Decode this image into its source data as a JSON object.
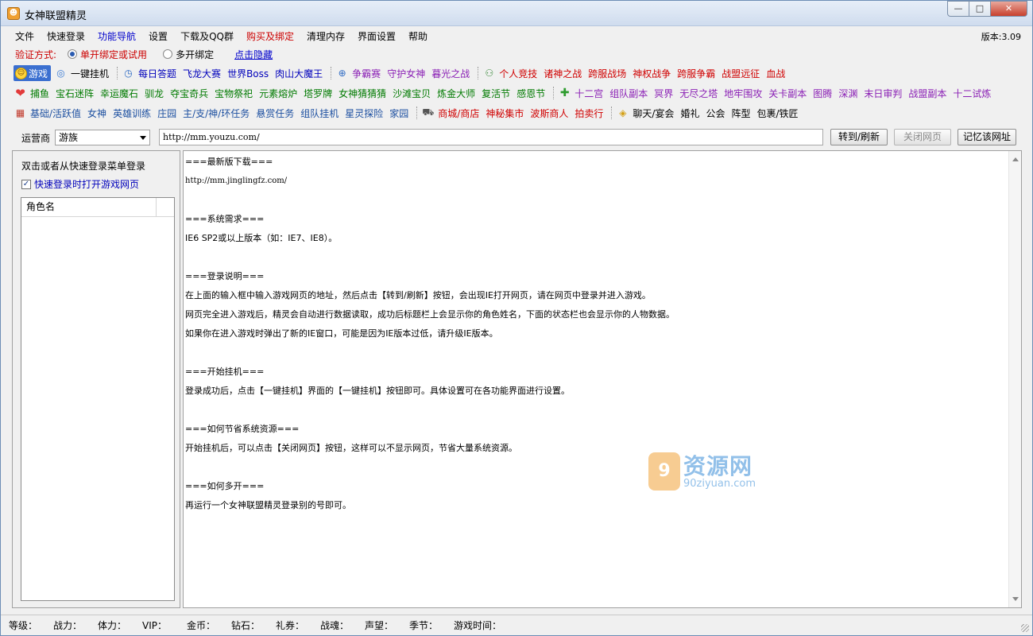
{
  "window": {
    "title": "女神联盟精灵",
    "controls": {
      "minimize": "—",
      "maximize": "□",
      "close": "✕"
    }
  },
  "menu": {
    "items": [
      {
        "label": "文件",
        "color": "black"
      },
      {
        "label": "快速登录",
        "color": "black"
      },
      {
        "label": "功能导航",
        "color": "blue"
      },
      {
        "label": "设置",
        "color": "black"
      },
      {
        "label": "下载及QQ群",
        "color": "black"
      },
      {
        "label": "购买及绑定",
        "color": "red"
      },
      {
        "label": "清理内存",
        "color": "black"
      },
      {
        "label": "界面设置",
        "color": "black"
      },
      {
        "label": "帮助",
        "color": "black"
      }
    ],
    "version": "版本:3.09"
  },
  "verify": {
    "label": "验证方式:",
    "option_single": "单开绑定或试用",
    "option_multi": "多开绑定",
    "hide_link": "点击隐藏"
  },
  "toolbar1": {
    "game": "游戏",
    "auto": "一键挂机",
    "group_a": [
      "每日答题",
      "飞龙大赛",
      "世界Boss",
      "肉山大魔王"
    ],
    "group_b": [
      "争霸赛",
      "守护女神",
      "暮光之战"
    ],
    "group_c": [
      "个人竞技",
      "诸神之战",
      "跨服战场",
      "神权战争",
      "跨服争霸",
      "战盟远征",
      "血战"
    ]
  },
  "toolbar2": {
    "group_a": [
      "捕鱼",
      "宝石迷阵",
      "幸运魔石",
      "驯龙",
      "夺宝奇兵",
      "宝物祭祀",
      "元素熔炉",
      "塔罗牌",
      "女神猜猜猜",
      "沙滩宝贝",
      "炼金大师",
      "复活节",
      "感恩节"
    ],
    "group_b": [
      "十二宫",
      "组队副本",
      "冥界",
      "无尽之塔",
      "地牢围攻",
      "关卡副本",
      "图腾",
      "深渊",
      "末日审判",
      "战盟副本",
      "十二试炼"
    ]
  },
  "toolbar3": {
    "group_a": [
      "基础/活跃值",
      "女神",
      "英雄训练",
      "庄园",
      "主/支/神/环任务",
      "悬赏任务",
      "组队挂机",
      "星灵探险",
      "家园"
    ],
    "group_b": [
      "商城/商店",
      "神秘集市",
      "波斯商人",
      "拍卖行"
    ],
    "group_c": [
      "聊天/宴会",
      "婚礼",
      "公会",
      "阵型",
      "包裹/铁匠"
    ]
  },
  "address": {
    "operator_label": "运营商",
    "operator_value": "游族",
    "url": "http://mm.youzu.com/",
    "go_button": "转到/刷新",
    "close_button": "关闭网页",
    "remember_button": "记忆该网址"
  },
  "left_panel": {
    "hint": "双击或者从快速登录菜单登录",
    "checkbox_label": "快速登录时打开游戏网页",
    "checkbox_checked": true,
    "list_header": "角色名"
  },
  "content": {
    "lines": [
      "===最新版下载===",
      "http://mm.jinglingfz.com/",
      "",
      "===系统需求===",
      "IE6 SP2或以上版本（如：IE7、IE8）。",
      "",
      "===登录说明===",
      "在上面的输入框中输入游戏网页的地址，然后点击【转到/刷新】按钮，会出现IE打开网页，请在网页中登录并进入游戏。",
      "网页完全进入游戏后，精灵会自动进行数据读取，成功后标题栏上会显示你的角色姓名，下面的状态栏也会显示你的人物数据。",
      "如果你在进入游戏时弹出了新的IE窗口，可能是因为IE版本过低，请升级IE版本。",
      "",
      "===开始挂机===",
      "登录成功后，点击【一键挂机】界面的【一键挂机】按钮即可。具体设置可在各功能界面进行设置。",
      "",
      "===如何节省系统资源===",
      "开始挂机后，可以点击【关闭网页】按钮，这样可以不显示网页，节省大量系统资源。",
      "",
      "===如何多开===",
      "再运行一个女神联盟精灵登录别的号即可。"
    ]
  },
  "watermark": {
    "main": "资源网",
    "sub": "90ziyuan.com",
    "logo": "9"
  },
  "status": {
    "items": [
      "等级：",
      "战力：",
      "体力：",
      "VIP：",
      "金币：",
      "钻石：",
      "礼券：",
      "战魂：",
      "声望：",
      "季节：",
      "游戏时间："
    ]
  }
}
